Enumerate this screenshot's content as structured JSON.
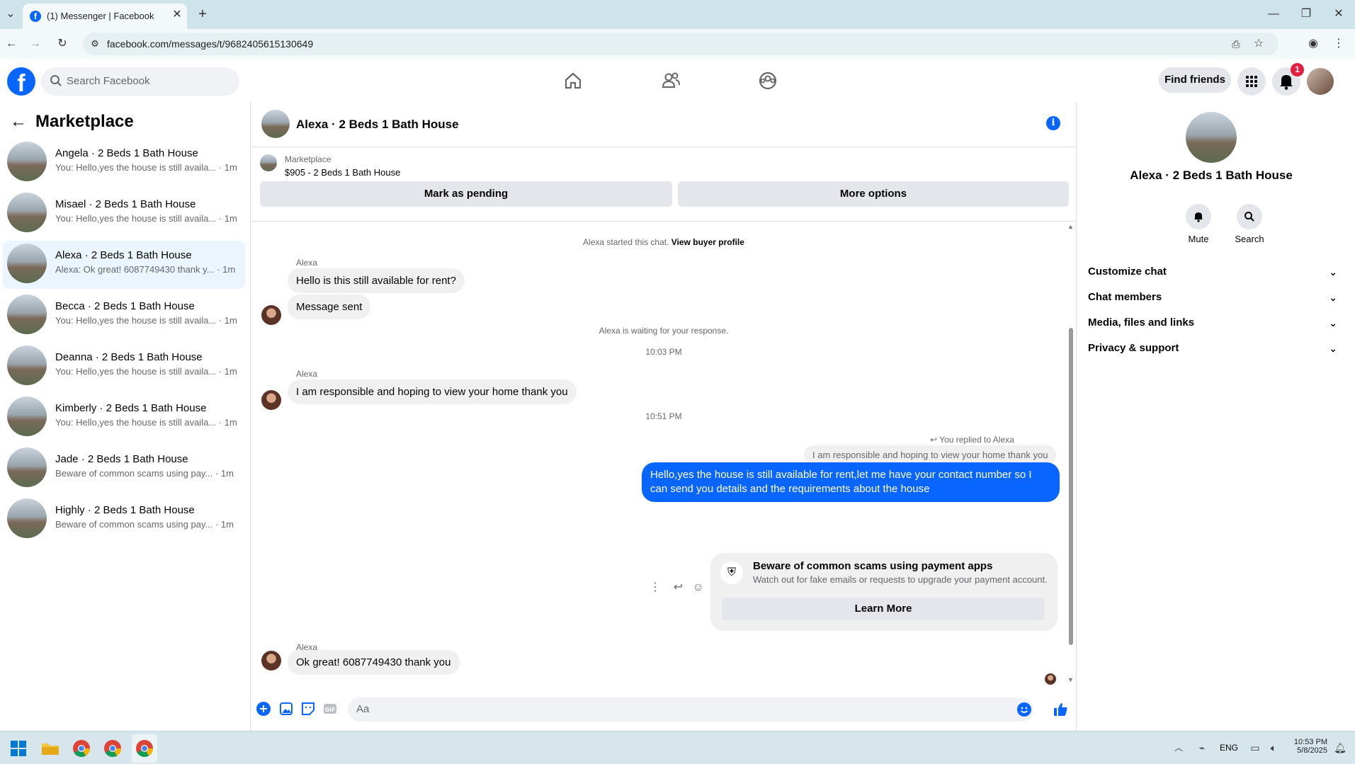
{
  "browser": {
    "tab_title": "(1) Messenger | Facebook",
    "url": "facebook.com/messages/t/9682405615130649"
  },
  "header": {
    "search_placeholder": "Search Facebook",
    "find_friends": "Find friends",
    "notification_count": "1"
  },
  "sidebar": {
    "title": "Marketplace",
    "conversations": [
      {
        "name": "Angela · 2 Beds 1 Bath House",
        "snippet": "You: Hello,yes the house is still availa...",
        "time": "· 1m"
      },
      {
        "name": "Misael · 2 Beds 1 Bath House",
        "snippet": "You: Hello,yes the house is still availa...",
        "time": "· 1m"
      },
      {
        "name": "Alexa · 2 Beds 1 Bath House",
        "snippet": "Alexa: Ok great! 6087749430 thank y...",
        "time": "· 1m"
      },
      {
        "name": "Becca · 2 Beds 1 Bath House",
        "snippet": "You: Hello,yes the house is still availa...",
        "time": "· 1m"
      },
      {
        "name": "Deanna · 2 Beds 1 Bath House",
        "snippet": "You: Hello,yes the house is still availa...",
        "time": "· 1m"
      },
      {
        "name": "Kimberly · 2 Beds 1 Bath House",
        "snippet": "You: Hello,yes the house is still availa...",
        "time": "· 1m"
      },
      {
        "name": "Jade · 2 Beds 1 Bath House",
        "snippet": "Beware of common scams using pay...",
        "time": "· 1m"
      },
      {
        "name": "Highly · 2 Beds 1 Bath House",
        "snippet": "Beware of common scams using pay...",
        "time": "· 1m"
      }
    ]
  },
  "chat": {
    "title": "Alexa · 2 Beds 1 Bath House",
    "marketplace_label": "Marketplace",
    "listing": "$905 - 2 Beds 1 Bath House",
    "mark_pending": "Mark as pending",
    "more_options": "More options",
    "started_text": "Alexa started this chat.",
    "view_buyer": "View buyer profile",
    "sender": "Alexa",
    "msg1": "Hello is this still available for rent?",
    "msg2": "Message sent",
    "waiting": "Alexa is waiting for your response.",
    "time1": "10:03 PM",
    "msg3": "I am responsible and hoping to view your home thank you",
    "time2": "10:51 PM",
    "replied_to": "You replied to Alexa",
    "quoted": "I am responsible and hoping to view your home thank you",
    "my_msg": "Hello,yes the house is still available for rent,let me have your contact number   so I can send you details and the requirements about the house",
    "scam_title": "Beware of common scams using payment apps",
    "scam_sub": "Watch out for fake emails or requests to upgrade your payment account.",
    "learn_more": "Learn More",
    "msg4": "Ok great! 6087749430 thank you",
    "composer_placeholder": "Aa"
  },
  "details": {
    "title": "Alexa · 2 Beds 1 Bath House",
    "mute": "Mute",
    "search": "Search",
    "sections": [
      "Customize chat",
      "Chat members",
      "Media, files and links",
      "Privacy & support"
    ]
  },
  "taskbar": {
    "lang": "ENG",
    "time": "10:53 PM",
    "date": "5/8/2025"
  },
  "colors": {
    "accent": "#0866ff",
    "active_row": "#ebf5ff",
    "badge": "#e41e3f"
  }
}
